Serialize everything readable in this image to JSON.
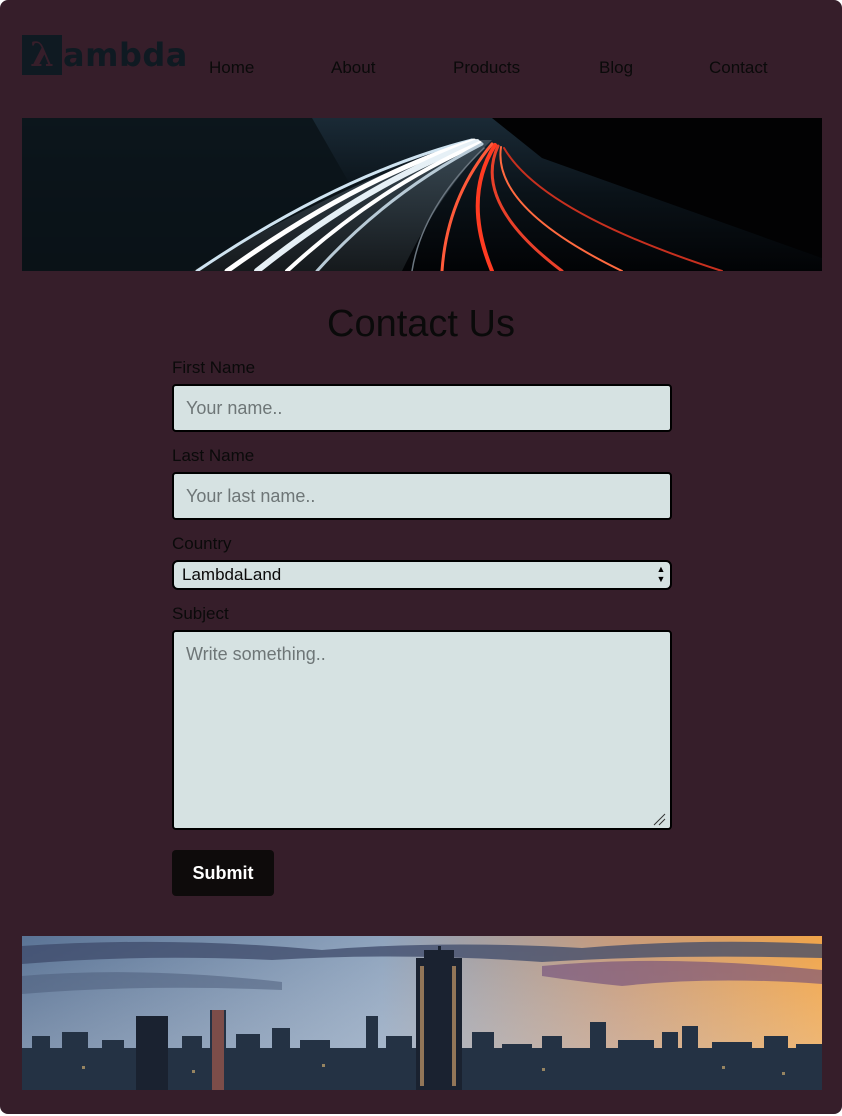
{
  "header": {
    "logo_mark": "λ",
    "logo_text": "ambda",
    "nav": [
      "Home",
      "About",
      "Products",
      "Blog",
      "Contact"
    ]
  },
  "form": {
    "title": "Contact Us",
    "first_name_label": "First Name",
    "first_name_placeholder": "Your name..",
    "last_name_label": "Last Name",
    "last_name_placeholder": "Your last name..",
    "country_label": "Country",
    "country_value": "LambdaLand",
    "subject_label": "Subject",
    "subject_placeholder": "Write something..",
    "submit_label": "Submit"
  },
  "colors": {
    "page_bg": "#361e2a",
    "field_bg": "#d6e2e2",
    "button_bg": "#0e0b0b"
  }
}
